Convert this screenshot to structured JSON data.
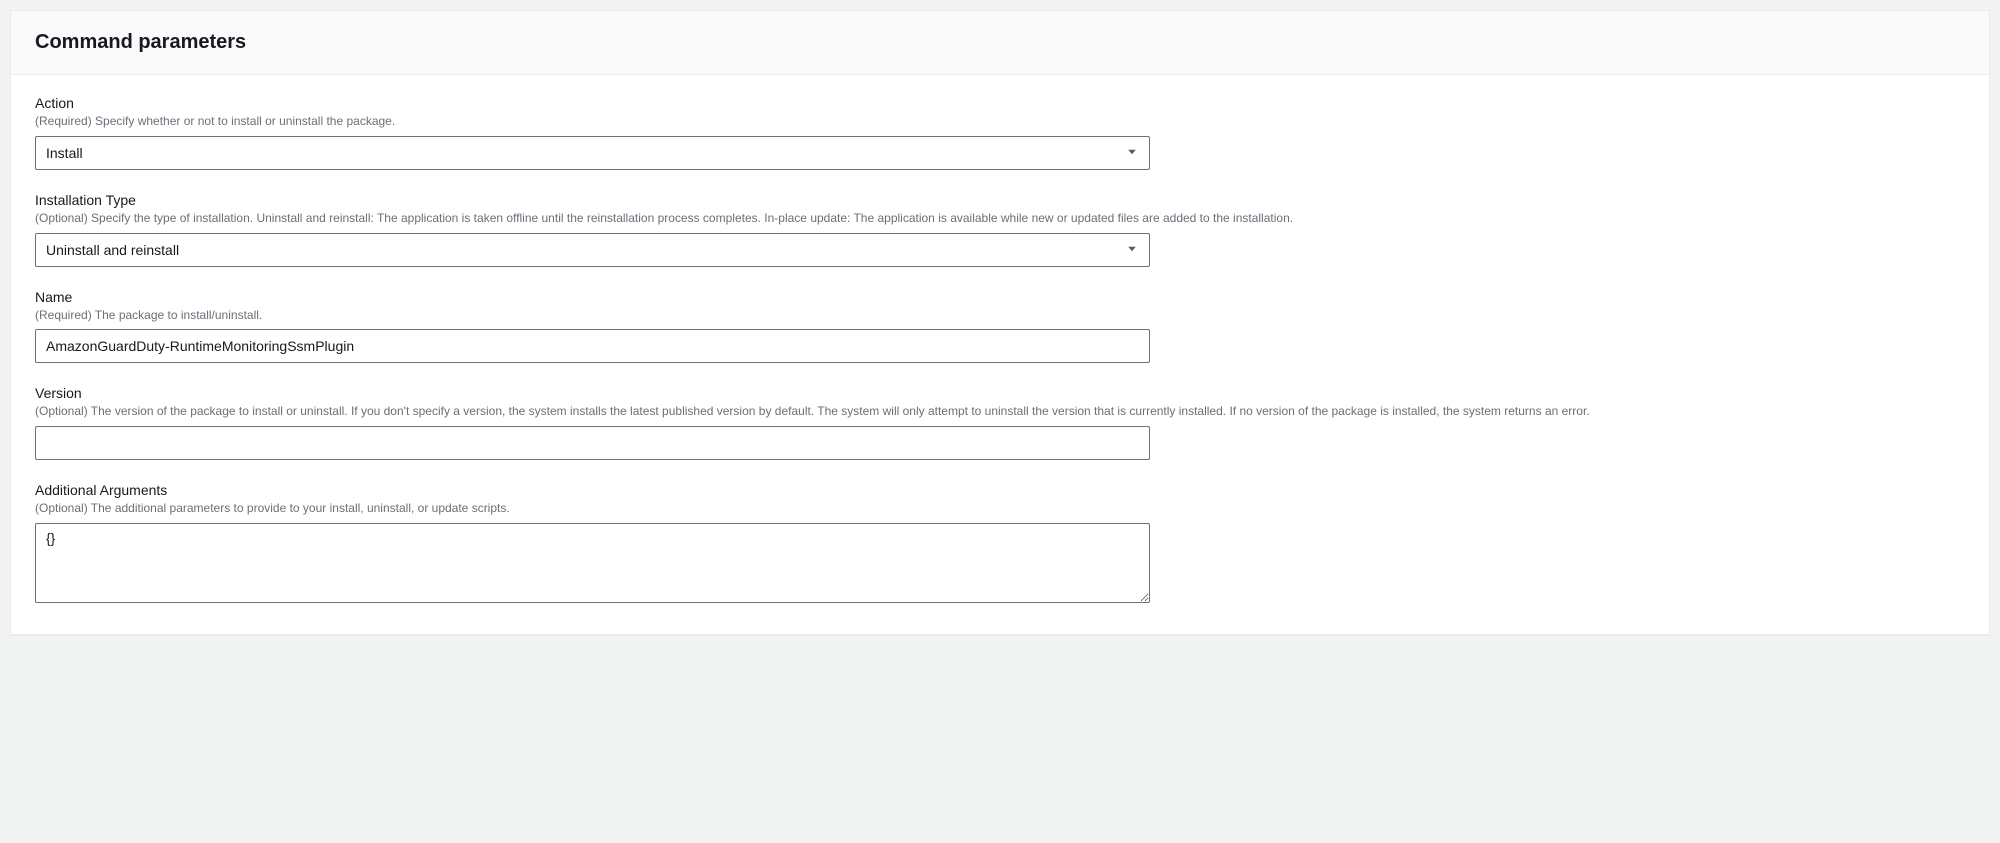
{
  "panel": {
    "title": "Command parameters"
  },
  "fields": {
    "action": {
      "label": "Action",
      "hint": "(Required) Specify whether or not to install or uninstall the package.",
      "value": "Install"
    },
    "installationType": {
      "label": "Installation Type",
      "hint": "(Optional) Specify the type of installation. Uninstall and reinstall: The application is taken offline until the reinstallation process completes. In-place update: The application is available while new or updated files are added to the installation.",
      "value": "Uninstall and reinstall"
    },
    "name": {
      "label": "Name",
      "hint": "(Required) The package to install/uninstall.",
      "value": "AmazonGuardDuty-RuntimeMonitoringSsmPlugin"
    },
    "version": {
      "label": "Version",
      "hint": "(Optional) The version of the package to install or uninstall. If you don't specify a version, the system installs the latest published version by default. The system will only attempt to uninstall the version that is currently installed. If no version of the package is installed, the system returns an error.",
      "value": ""
    },
    "additionalArguments": {
      "label": "Additional Arguments",
      "hint": "(Optional) The additional parameters to provide to your install, uninstall, or update scripts.",
      "value": "{}"
    }
  }
}
